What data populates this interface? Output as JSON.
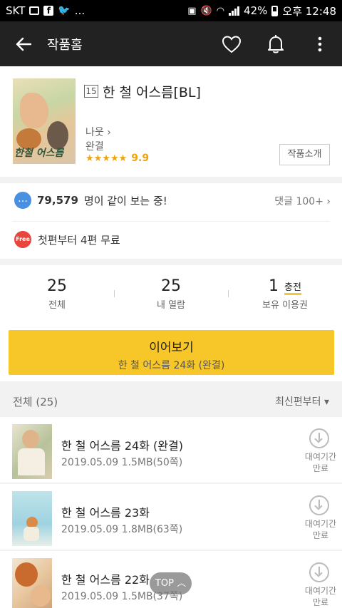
{
  "statusbar": {
    "carrier": "SKT",
    "extra": "...",
    "battery": "42%",
    "time": "오후 12:48"
  },
  "appbar": {
    "title": "작품홈",
    "icons": [
      "back-arrow-icon",
      "heart-icon",
      "bell-icon",
      "more-vert-icon"
    ]
  },
  "work": {
    "age_rating": "15",
    "title": "한 철 어스름[BL]",
    "author": "나웃",
    "author_chevron": "›",
    "status": "완결",
    "stars": "★★★★★",
    "score": "9.9",
    "intro_button": "작품소개",
    "cover_text": "한철 어스름"
  },
  "social": {
    "viewers_count": "79,579",
    "viewers_text": "명이 같이 보는 중!",
    "comments": "댓글 100+ ›",
    "free_badge": "Free",
    "free_text": "첫편부터 4편 무료"
  },
  "counts": [
    {
      "number": "25",
      "label": "전체"
    },
    {
      "number": "25",
      "label": "내 열람"
    },
    {
      "number": "1",
      "label": "보유 이용권",
      "extra": "충전"
    }
  ],
  "continue": {
    "label": "이어보기",
    "sub": "한 철 어스름 24화 (완결)"
  },
  "list": {
    "total": "전체 (25)",
    "sort": "최신편부터 ▾"
  },
  "episodes": [
    {
      "title": "한 철 어스름 24화 (완결)",
      "meta": "2019.05.09  1.5MB(50쪽)",
      "rent": "대여기간\n만료"
    },
    {
      "title": "한 철 어스름 23화",
      "meta": "2019.05.09  1.8MB(63쪽)",
      "rent": "대여기간\n만료"
    },
    {
      "title": "한 철 어스름 22화",
      "meta": "2019.05.09  1.5MB(37쪽)",
      "rent": "대여기간\n만료"
    }
  ],
  "top_button": "TOP ︿",
  "colors": {
    "appbar": "#222222",
    "accent": "#f7c628",
    "star": "#f0a30a",
    "free_badge": "#e8453c",
    "chat_icon": "#4a90e2"
  }
}
